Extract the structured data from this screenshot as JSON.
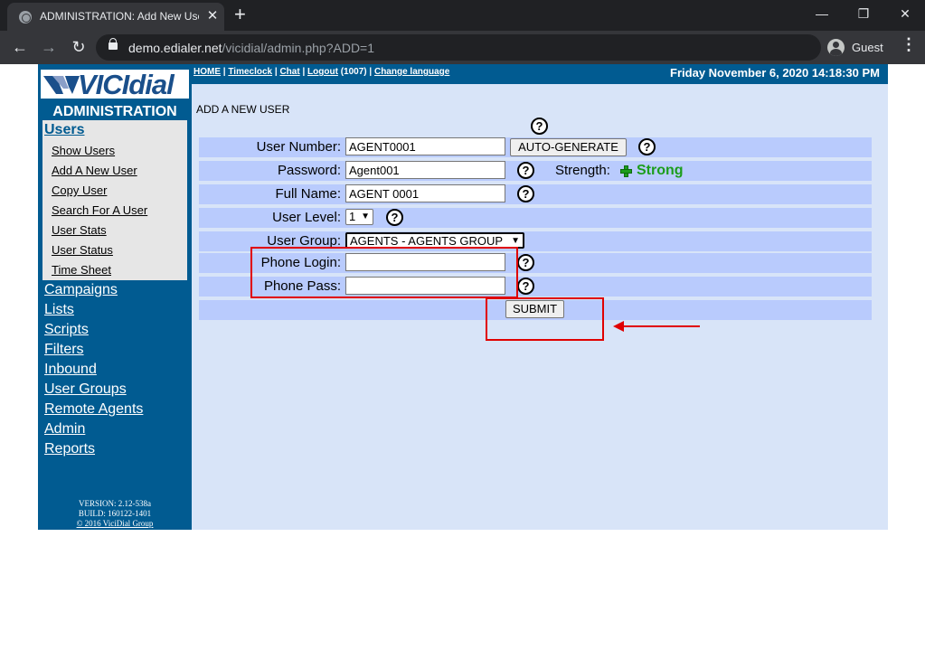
{
  "browser": {
    "tab_title": "ADMINISTRATION: Add New User",
    "tab_close": "✕",
    "new_tab": "+",
    "url_host": "demo.edialer.net",
    "url_path": "/vicidial/admin.php?ADD=1",
    "profile_label": "Guest",
    "window_controls": {
      "minimize": "—",
      "maximize": "❐",
      "close": "✕"
    },
    "nav": {
      "back": "←",
      "forward": "→",
      "reload": "↻"
    },
    "menu": "⋮"
  },
  "sidebar": {
    "logo_text": "VICIdial",
    "admin_title": "ADMINISTRATION",
    "users_label": "Users",
    "users_items": [
      "Show Users",
      "Add A New User",
      "Copy User",
      "Search For A User",
      "User Stats",
      "User Status",
      "Time Sheet"
    ],
    "nav_items": [
      "Campaigns",
      "Lists",
      "Scripts",
      "Filters",
      "Inbound",
      "User Groups",
      "Remote Agents",
      "Admin",
      "Reports"
    ],
    "version": "VERSION: 2.12-538a",
    "build": "BUILD: 160122-1401",
    "copyright": "© 2016 ViciDial Group"
  },
  "header": {
    "links": [
      "HOME",
      "Timeclock",
      "Chat",
      "Logout",
      "Change language"
    ],
    "logout_suffix": " (1007) ",
    "separator": " | ",
    "date": "Friday November 6, 2020 14:18:30 PM"
  },
  "form": {
    "title": "ADD A NEW USER",
    "help_glyph": "?",
    "user_number_label": "User Number:",
    "user_number_value": "AGENT0001",
    "auto_generate_label": "AUTO-GENERATE",
    "password_label": "Password:",
    "password_value": "Agent001",
    "strength_label": "Strength:",
    "strength_value": "Strong",
    "full_name_label": "Full Name:",
    "full_name_value": "AGENT 0001",
    "user_level_label": "User Level:",
    "user_level_value": "1",
    "user_group_label": "User Group:",
    "user_group_value": "AGENTS - AGENTS GROUP",
    "phone_login_label": "Phone Login:",
    "phone_login_value": "",
    "phone_pass_label": "Phone Pass:",
    "phone_pass_value": "",
    "submit_label": "SUBMIT"
  },
  "colors": {
    "sidebar_bg": "#015b91",
    "main_bg": "#d8e4f8",
    "row_bg": "#b9cbfd",
    "strength_color": "#1c9d1c",
    "annotation_color": "#e00000"
  }
}
